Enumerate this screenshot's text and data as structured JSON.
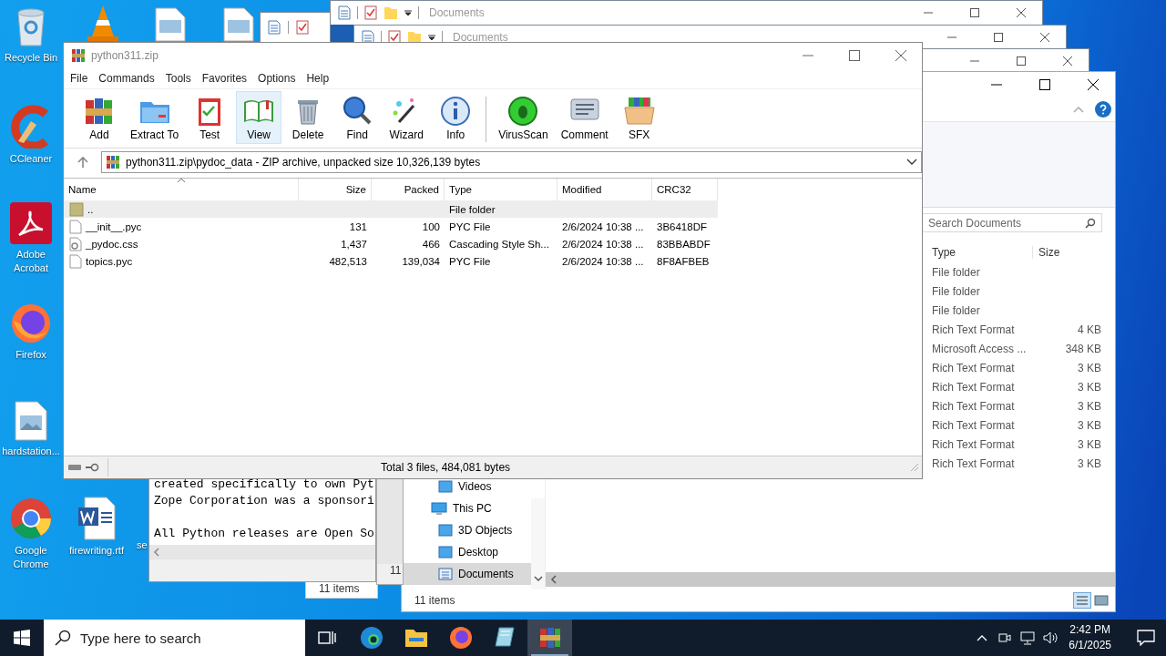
{
  "desktop_icons": [
    {
      "label": "Recycle Bin"
    },
    {
      "label": "CCleaner"
    },
    {
      "label": "Adobe Acrobat"
    },
    {
      "label": "Firefox"
    },
    {
      "label": "hardstation..."
    },
    {
      "label": "Google Chrome"
    },
    {
      "label": "firewriting.rtf"
    },
    {
      "label": "se"
    }
  ],
  "back_windows": [
    {
      "title": "Documents"
    },
    {
      "title": "Documents"
    }
  ],
  "explorer": {
    "search": {
      "placeholder": "Search Documents"
    },
    "columns": [
      "Type",
      "Size"
    ],
    "rows": [
      {
        "type": "File folder"
      },
      {
        "type": "File folder"
      },
      {
        "type": "File folder"
      },
      {
        "type": "Rich Text Format",
        "size": "4 KB"
      },
      {
        "type": "Microsoft Access ...",
        "size": "348 KB"
      },
      {
        "type": "Rich Text Format",
        "size": "3 KB"
      },
      {
        "type": "Rich Text Format",
        "size": "3 KB"
      },
      {
        "type": "Rich Text Format",
        "size": "3 KB"
      },
      {
        "type": "Rich Text Format",
        "size": "3 KB"
      },
      {
        "type": "Rich Text Format",
        "size": "3 KB"
      },
      {
        "type": "Rich Text Format",
        "size": "3 KB"
      }
    ],
    "nav": [
      {
        "children": [
          {
            "label": "Videos",
            "selected": false
          }
        ]
      },
      {
        "label": "This PC",
        "selected": false,
        "children": [
          {
            "label": "3D Objects",
            "selected": false
          },
          {
            "label": "Desktop",
            "selected": false
          },
          {
            "label": "Documents",
            "selected": true
          }
        ]
      }
    ],
    "status": "11 items"
  },
  "notepad": {
    "paragraphs": [
      [
        "created specifically to own Pyt",
        "Zope Corporation was a sponsori"
      ],
      [
        "All Python releases are Open So"
      ]
    ],
    "status": "11"
  },
  "explorer_small": {
    "status": "11 items"
  },
  "winrar": {
    "title": "python311.zip",
    "menu": [
      "File",
      "Commands",
      "Tools",
      "Favorites",
      "Options",
      "Help"
    ],
    "toolbar_groups": [
      [
        {
          "label": "Add",
          "selected": false
        },
        {
          "label": "Extract To",
          "selected": false
        },
        {
          "label": "Test",
          "selected": false
        },
        {
          "label": "View",
          "selected": true
        },
        {
          "label": "Delete",
          "selected": false
        },
        {
          "label": "Find",
          "selected": false
        },
        {
          "label": "Wizard",
          "selected": false
        },
        {
          "label": "Info",
          "selected": false
        }
      ],
      [
        {
          "label": "VirusScan",
          "selected": false
        },
        {
          "label": "Comment",
          "selected": false
        },
        {
          "label": "SFX",
          "selected": false
        }
      ]
    ],
    "path": "python311.zip\\pydoc_data - ZIP archive, unpacked size 10,326,139 bytes",
    "columns": [
      {
        "label": "Name",
        "sorted": true
      },
      {
        "label": "Size",
        "sorted": false
      },
      {
        "label": "Packed",
        "sorted": false
      },
      {
        "label": "Type",
        "sorted": false
      },
      {
        "label": "Modified",
        "sorted": false
      },
      {
        "label": "CRC32",
        "sorted": false
      }
    ],
    "rows": [
      {
        "kind": "folder",
        "name": "..",
        "type": "File folder",
        "selected": true
      },
      {
        "kind": "file",
        "name": "__init__.pyc",
        "size": "131",
        "packed": "100",
        "type": "PYC File",
        "modified": "2/6/2024 10:38 ...",
        "crc": "3B6418DF",
        "selected": false
      },
      {
        "kind": "css",
        "name": "_pydoc.css",
        "size": "1,437",
        "packed": "466",
        "type": "Cascading Style Sh...",
        "modified": "2/6/2024 10:38 ...",
        "crc": "83BBABDF",
        "selected": false
      },
      {
        "kind": "file",
        "name": "topics.pyc",
        "size": "482,513",
        "packed": "139,034",
        "type": "PYC File",
        "modified": "2/6/2024 10:38 ...",
        "crc": "8F8AFBEB",
        "selected": false
      }
    ],
    "status": "Total 3 files, 484,081 bytes"
  },
  "taskbar": {
    "search": {
      "placeholder": "Type here to search"
    },
    "apps": [
      {
        "active": false
      },
      {
        "active": false
      },
      {
        "active": false
      },
      {
        "active": false
      },
      {
        "active": true
      }
    ],
    "time": "2:42 PM",
    "date": "6/1/2025"
  }
}
